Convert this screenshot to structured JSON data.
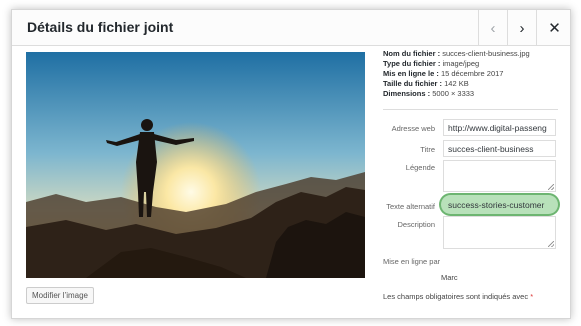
{
  "modal": {
    "title": "Détails du fichier joint",
    "prev_icon": "chevron-left-icon",
    "next_icon": "chevron-right-icon",
    "close_icon": "close-icon",
    "prev_glyph": "‹",
    "next_glyph": "›",
    "close_glyph": "✕"
  },
  "file_info": {
    "name_label": "Nom du fichier :",
    "name_value": "succes-client-business.jpg",
    "type_label": "Type du fichier :",
    "type_value": "image/jpeg",
    "uploaded_label": "Mis en ligne le :",
    "uploaded_value": "15 décembre 2017",
    "size_label": "Taille du fichier :",
    "size_value": "142 KB",
    "dimensions_label": "Dimensions :",
    "dimensions_value": "5000 × 3333"
  },
  "fields": {
    "url_label": "Adresse web",
    "url_value": "http://www.digital-passeng",
    "title_label": "Titre",
    "title_value": "succes-client-business",
    "caption_label": "Légende",
    "caption_value": "",
    "alt_label": "Texte alternatif",
    "alt_value": "success-stories-customer",
    "description_label": "Description",
    "description_value": ""
  },
  "uploader": {
    "label": "Mise en ligne par",
    "value": "Marc"
  },
  "footer": {
    "required_text": "Les champs obligatoires sont indiqués avec",
    "required_star": "*"
  },
  "actions": {
    "edit_image_label": "Modifier l’image"
  },
  "colors": {
    "highlight": "#7ec882",
    "required": "#dc3232"
  }
}
